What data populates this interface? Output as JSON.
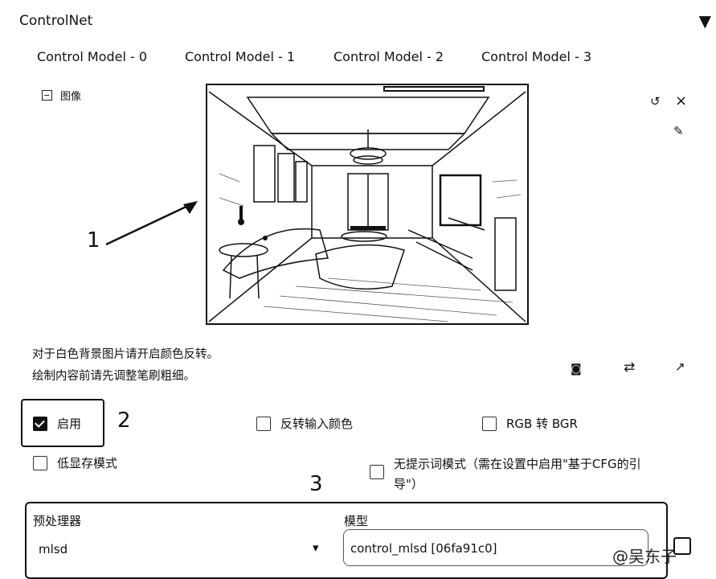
{
  "panel": {
    "title": "ControlNet",
    "collapse_glyph": "▼"
  },
  "tabs": [
    {
      "label": "Control Model - 0"
    },
    {
      "label": "Control Model - 1"
    },
    {
      "label": "Control Model - 2"
    },
    {
      "label": "Control Model - 3"
    }
  ],
  "image_input": {
    "label": "图像",
    "icon": "image-icon",
    "tools": {
      "undo": "↺",
      "close": "×",
      "brush": "✎"
    }
  },
  "annotations": {
    "one": "1",
    "two": "2",
    "three": "3"
  },
  "hints": {
    "line1": "对于白色背景图片请开启颜色反转。",
    "line2": "绘制内容前请先调整笔刷粗细。"
  },
  "canvas_tools": {
    "camera": "◙",
    "swap": "⇄",
    "send": "↗"
  },
  "checkboxes": {
    "enable": {
      "label": "启用",
      "checked": true
    },
    "invert": {
      "label": "反转输入颜色",
      "checked": false
    },
    "rgb_bgr": {
      "label": "RGB 转 BGR",
      "checked": false
    },
    "lowvram": {
      "label": "低显存模式",
      "checked": false
    },
    "guess_mode_line1": "无提示词模式（需在设置中启用\"基于CFG的引",
    "guess_mode_line2": "导\"）",
    "guess_mode_checked": false
  },
  "preprocessor": {
    "label": "预处理器",
    "value": "mlsd",
    "caret": "▾"
  },
  "model": {
    "label": "模型",
    "value": "control_mlsd [06fa91c0]"
  },
  "watermark": "@吴东子",
  "colors": {
    "ink": "#111111",
    "background": "#ffffff"
  }
}
